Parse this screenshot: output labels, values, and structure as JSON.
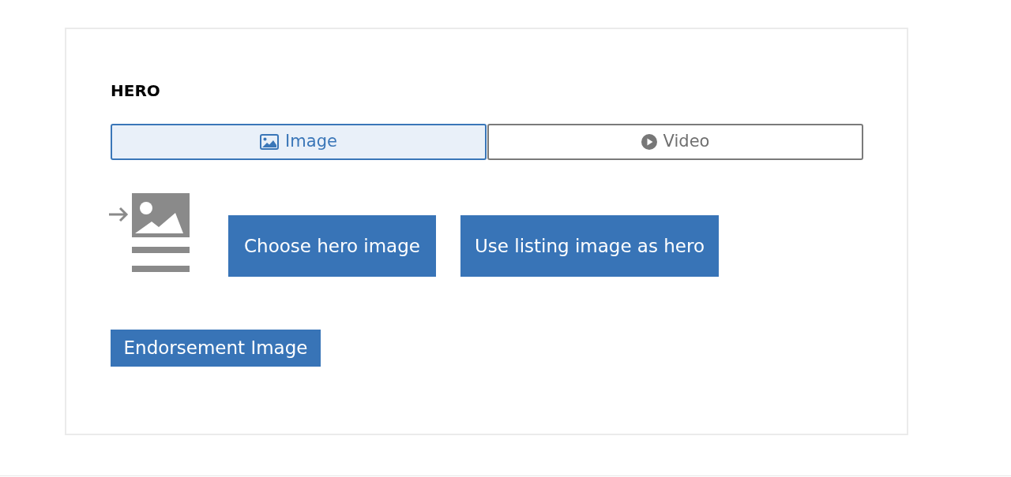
{
  "section": {
    "title": "HERO"
  },
  "tabs": [
    {
      "label": "Image",
      "kind": "image",
      "selected": true
    },
    {
      "label": "Video",
      "kind": "video",
      "selected": false
    }
  ],
  "actions": [
    {
      "label": "Choose hero image"
    },
    {
      "label": "Use listing image as hero"
    }
  ],
  "secondary_button": {
    "label": "Endorsement Image"
  }
}
